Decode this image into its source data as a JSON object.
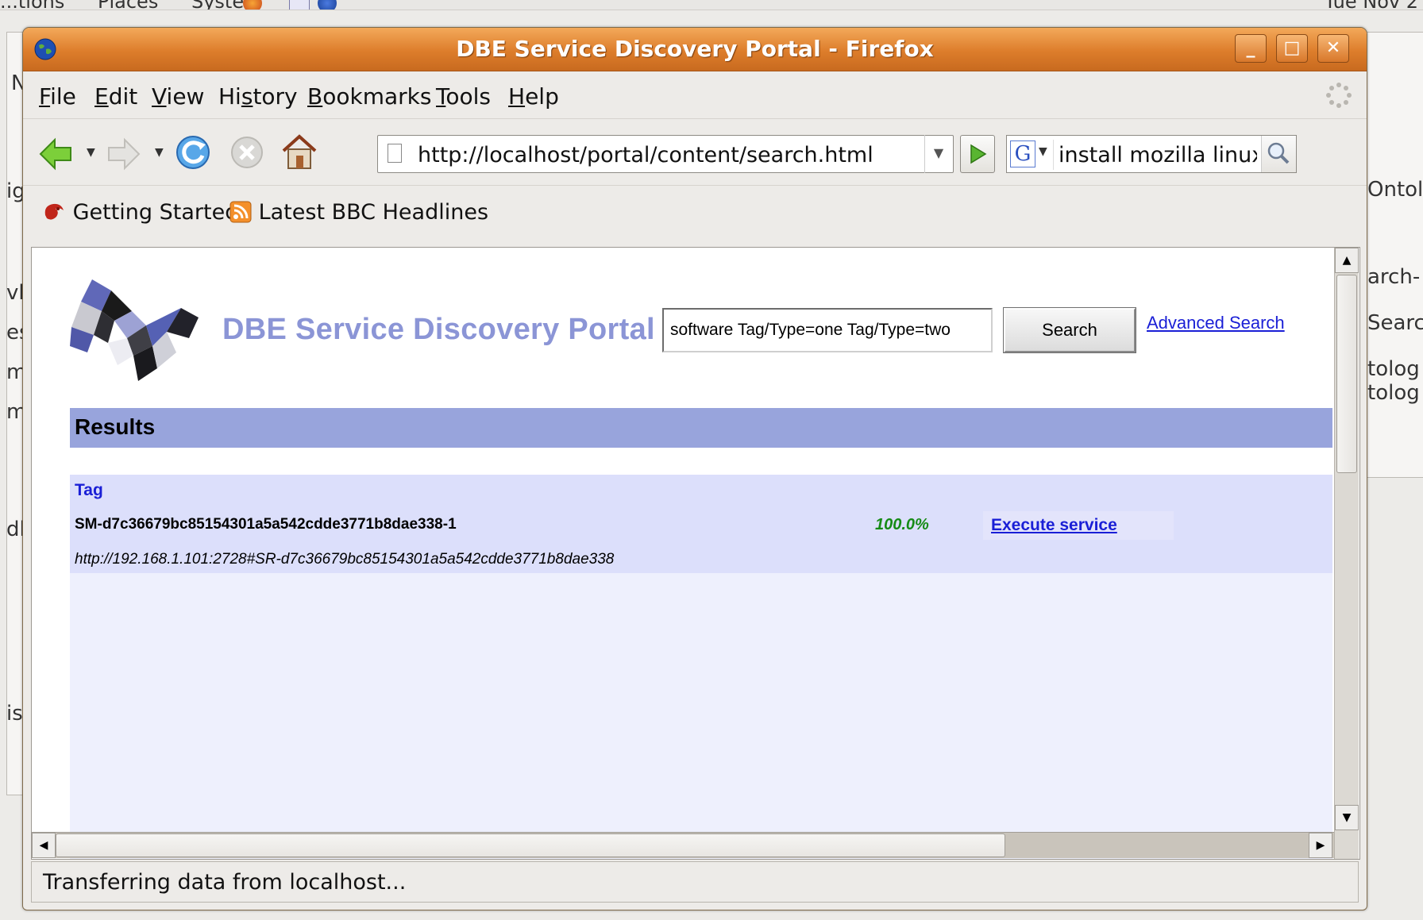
{
  "desktop": {
    "panel_menus": [
      "...tions",
      "Places",
      "System"
    ],
    "clock": "Tue Nov 2",
    "behind_left": [
      "N",
      "ig",
      "vh",
      "es",
      "m",
      "m",
      "dl",
      "is"
    ],
    "behind_right": [
      "Ontol",
      "arch-",
      "Searc",
      "tolog",
      "tolog"
    ]
  },
  "window": {
    "title": "DBE Service Discovery Portal - Firefox",
    "buttons": {
      "minimize": "_",
      "maximize": "□",
      "close": "✕"
    }
  },
  "menubar": {
    "items": [
      {
        "pre": "",
        "key": "F",
        "post": "ile"
      },
      {
        "pre": "",
        "key": "E",
        "post": "dit"
      },
      {
        "pre": "",
        "key": "V",
        "post": "iew"
      },
      {
        "pre": "Hi",
        "key": "s",
        "post": "tory"
      },
      {
        "pre": "",
        "key": "B",
        "post": "ookmarks"
      },
      {
        "pre": "",
        "key": "T",
        "post": "ools"
      },
      {
        "pre": "",
        "key": "H",
        "post": "elp"
      }
    ]
  },
  "navigation": {
    "url": "http://localhost/portal/content/search.html",
    "search_engine": "G",
    "search_value": "install mozilla linux"
  },
  "bookmarks": [
    {
      "label": "Getting Started",
      "icon": "firefox-icon"
    },
    {
      "label": "Latest BBC Headlines",
      "icon": "rss-feed-icon"
    }
  ],
  "page": {
    "site_title": "DBE Service Discovery Portal",
    "query_value": "software Tag/Type=one Tag/Type=two",
    "search_button": "Search",
    "advanced_link": "Advanced Search",
    "results_heading": "Results",
    "results": [
      {
        "tag": "Tag",
        "id": "SM-d7c36679bc85154301a5a542cdde3771b8dae338-1",
        "score": "100.0%",
        "action": "Execute service",
        "url": "http://192.168.1.101:2728#SR-d7c36679bc85154301a5a542cdde3771b8dae338"
      }
    ]
  },
  "status": {
    "text": "Transferring data from localhost..."
  },
  "colors": {
    "title_bar": "#dd7d2b",
    "site_title": "#8b95d6",
    "results_bar": "#98a4dc",
    "result_row": "#dcdffb",
    "link": "#1a1fd6",
    "score": "#168b16"
  }
}
